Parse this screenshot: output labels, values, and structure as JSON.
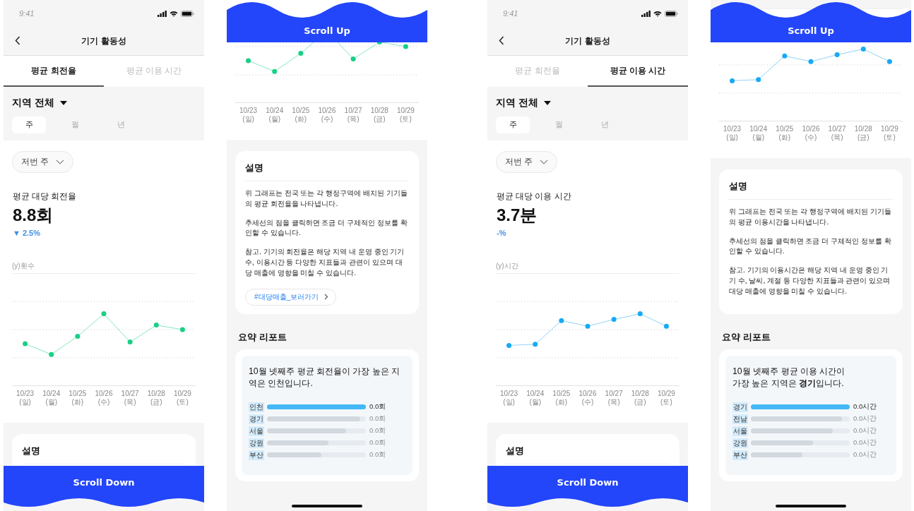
{
  "screens": [
    {
      "kind": "top",
      "status_bar": {
        "time": "9:41"
      },
      "title": "기기 활동성",
      "tabs": [
        {
          "label": "평균 회전율",
          "selected": true
        },
        {
          "label": "평균 이용 시간",
          "selected": false
        }
      ],
      "region": "지역 전체",
      "periods": [
        {
          "label": "주",
          "selected": true
        },
        {
          "label": "월",
          "selected": false
        },
        {
          "label": "년",
          "selected": false
        }
      ],
      "range_dropdown": "저번 주",
      "metric": {
        "label": "평균 대당 회전율",
        "value": "8.8회",
        "change": "▼ 2.5%"
      },
      "chart": {
        "kind": "rotation",
        "y_label": "(y)횟수",
        "x_labels": [
          "10/23\n(일)",
          "10/24\n(월)",
          "10/25\n(화)",
          "10/26\n(수)",
          "10/27\n(목)",
          "10/28\n(금)",
          "10/29\n(토)"
        ]
      },
      "description": {
        "title": "설명"
      },
      "overlay": {
        "label": "Scroll Down"
      }
    },
    {
      "kind": "bottom",
      "overlay": {
        "label": "Scroll Up"
      },
      "chart": {
        "kind": "rotation",
        "x_labels": [
          "10/23\n(일)",
          "10/24\n(월)",
          "10/25\n(화)",
          "10/26\n(수)",
          "10/27\n(목)",
          "10/28\n(금)",
          "10/29\n(토)"
        ]
      },
      "description": {
        "title": "설명",
        "paragraphs": [
          "위 그래프는 전국 또는 각 행정구역에 배치된 기기들의 평균 회전율을 나타냅니다.",
          "추세선의 점을 클릭하면 조금 더 구체적인 정보를 확인할 수 있습니다.",
          "참고. 기기의 회전율은 해당 지역 내 운영 중인 기기 수, 이용시간 등 다양한 지표들과 관련이 있으며 대당 매출에 영향을 미칠 수 있습니다."
        ],
        "link": "#대당매출_보러가기"
      },
      "report": {
        "title": "요약 리포트",
        "headline": "10월 넷째주 평균 회전율이 가장 높은 지역은 인천입니다.",
        "bars": [
          {
            "region": "인천",
            "value": "0.0회",
            "level": 1.0,
            "highlighted": true
          },
          {
            "region": "경기",
            "value": "0.0회",
            "level": 0.94,
            "highlighted": false
          },
          {
            "region": "서울",
            "value": "0.0회",
            "level": 0.8,
            "highlighted": false
          },
          {
            "region": "강원",
            "value": "0.0회",
            "level": 0.62,
            "highlighted": false
          },
          {
            "region": "부산",
            "value": "0.0회",
            "level": 0.55,
            "highlighted": false
          }
        ]
      }
    },
    {
      "kind": "top",
      "status_bar": {
        "time": "9:41"
      },
      "title": "기기 활동성",
      "tabs": [
        {
          "label": "평균 회전율",
          "selected": false
        },
        {
          "label": "평균 이용 시간",
          "selected": true
        }
      ],
      "region": "지역 전체",
      "periods": [
        {
          "label": "주",
          "selected": true
        },
        {
          "label": "월",
          "selected": false
        },
        {
          "label": "년",
          "selected": false
        }
      ],
      "range_dropdown": "저번 주",
      "metric": {
        "label": "평균 대당 이용 시간",
        "value": "3.7분",
        "change": "-%"
      },
      "chart": {
        "kind": "usage",
        "y_label": "(y)시간",
        "x_labels": [
          "10/23\n(일)",
          "10/24\n(월)",
          "10/25\n(화)",
          "10/26\n(수)",
          "10/27\n(목)",
          "10/28\n(금)",
          "10/29\n(토)"
        ]
      },
      "description": {
        "title": "설명"
      },
      "overlay": {
        "label": "Scroll Down"
      }
    },
    {
      "kind": "bottom",
      "overlay": {
        "label": "Scroll Up"
      },
      "chart": {
        "kind": "usage",
        "x_labels": [
          "10/23\n(일)",
          "10/24\n(월)",
          "10/25\n(화)",
          "10/26\n(수)",
          "10/27\n(목)",
          "10/28\n(금)",
          "10/29\n(토)"
        ]
      },
      "description": {
        "title": "설명",
        "paragraphs": [
          "위 그래프는 전국 또는 각 행정구역에 배치된 기기들의 평균 이용시간을 나타냅니다.",
          "추세선의 점을 클릭하면 조금 더 구체적인 정보를 확인할 수 있습니다.",
          "참고. 기기의 이용시간은 해당 지역 내 운영 중인 기기 수, 날씨, 계절 등 다양한 지표들과 관련이 있으며 대당 매출에 영향을 미칠 수 있습니다."
        ]
      },
      "report": {
        "title": "요약 리포트",
        "headline": "10월 넷째주 평균 이용 시간이\n가장 높은 지역은 **경기**입니다.",
        "bars": [
          {
            "region": "경기",
            "value": "0.0시간",
            "level": 1.0,
            "highlighted": true
          },
          {
            "region": "전남",
            "value": "0.0시간",
            "level": 0.92,
            "highlighted": false
          },
          {
            "region": "서울",
            "value": "0.0시간",
            "level": 0.83,
            "highlighted": false
          },
          {
            "region": "강원",
            "value": "0.0시간",
            "level": 0.63,
            "highlighted": false
          },
          {
            "region": "부산",
            "value": "0.0시간",
            "level": 0.52,
            "highlighted": false
          }
        ]
      }
    }
  ]
}
